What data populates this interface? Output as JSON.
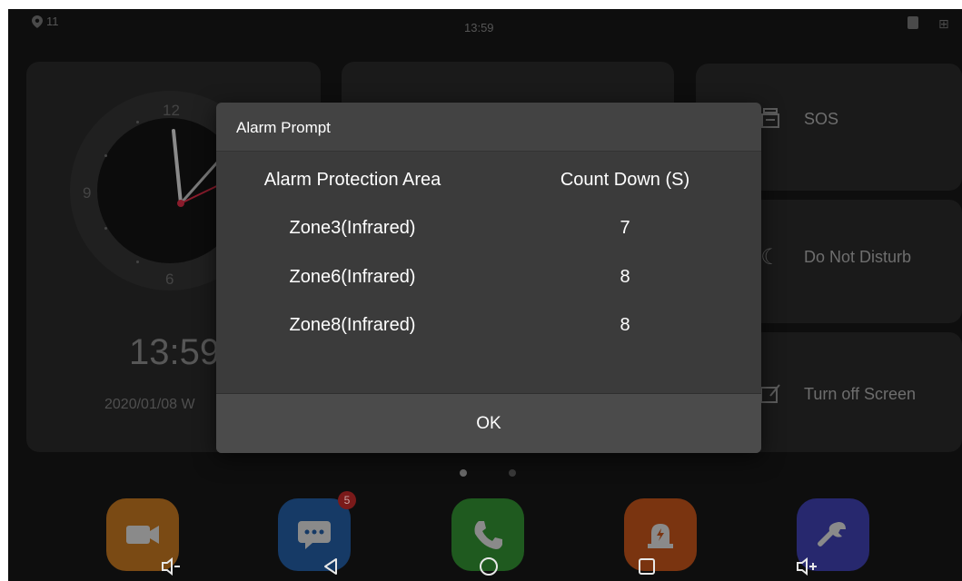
{
  "status_bar": {
    "location_count": "11",
    "time": "13:59"
  },
  "clock": {
    "numerals": [
      "12",
      "9",
      "6"
    ],
    "big_time": "13:59",
    "date": "2020/01/08  W"
  },
  "quick_actions": [
    {
      "label": "SOS",
      "icon": "sos-icon"
    },
    {
      "label": "Do Not Disturb",
      "icon": "moon-icon"
    },
    {
      "label": "Turn off Screen",
      "icon": "screen-off-icon"
    }
  ],
  "apps": [
    {
      "icon": "camera-icon",
      "color": "#7a4a14"
    },
    {
      "icon": "message-icon",
      "color": "#163a66",
      "badge": "5"
    },
    {
      "icon": "phone-icon",
      "color": "#1f5a1f"
    },
    {
      "icon": "alarm-icon",
      "color": "#7a3410"
    },
    {
      "icon": "wrench-icon",
      "color": "#27286e"
    }
  ],
  "nav": {
    "volume_down": "volume-down-icon",
    "back": "back-icon",
    "home": "home-icon",
    "recents": "recents-icon",
    "volume_up": "volume-up-icon"
  },
  "dialog": {
    "title": "Alarm Prompt",
    "headers": {
      "area": "Alarm Protection Area",
      "countdown": "Count Down (S)"
    },
    "rows": [
      {
        "area": "Zone3(Infrared)",
        "countdown": "7"
      },
      {
        "area": "Zone6(Infrared)",
        "countdown": "8"
      },
      {
        "area": "Zone8(Infrared)",
        "countdown": "8"
      }
    ],
    "ok_label": "OK"
  },
  "colors": {
    "dialog_bg": "#434343",
    "dim_background": "#0e0e0e",
    "accent_red": "#c0253a"
  }
}
